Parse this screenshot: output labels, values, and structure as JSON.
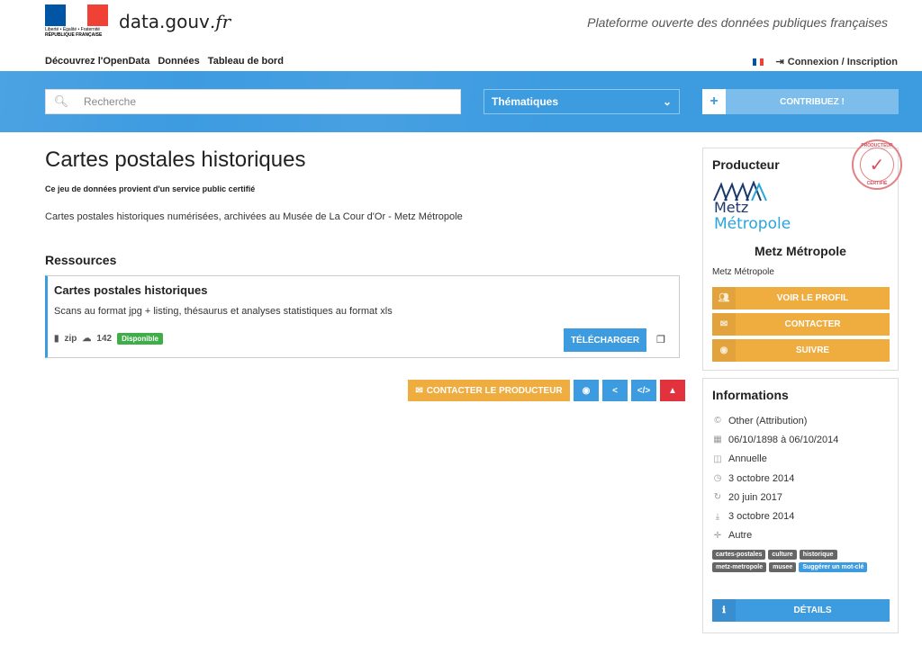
{
  "header": {
    "logo_lines": [
      "Liberté • Égalité • Fraternité",
      "RÉPUBLIQUE FRANÇAISE"
    ],
    "brand_main": "data.gouv",
    "brand_tld": ".fr",
    "tagline": "Plateforme ouverte des données publiques françaises",
    "nav": [
      "Découvrez l'OpenData",
      "Données",
      "Tableau de bord"
    ],
    "login": "Connexion / Inscription",
    "colors": {
      "blue": "#0055a4",
      "white": "#ffffff",
      "red": "#ef4135"
    }
  },
  "search": {
    "placeholder": "Recherche",
    "themes_label": "Thématiques",
    "contribute_label": "CONTRIBUEZ !"
  },
  "dataset": {
    "title": "Cartes postales historiques",
    "certified_note": "Ce jeu de données provient d'un service public certifié",
    "description": "Cartes postales historiques numérisées, archivées au Musée de La Cour d'Or - Metz Métropole"
  },
  "resources": {
    "heading": "Ressources",
    "items": [
      {
        "title": "Cartes postales historiques",
        "description": "Scans au format jpg + listing, thésaurus et analyses statistiques au format xls",
        "format": "zip",
        "downloads": "142",
        "status": "Disponible",
        "download_label": "TÉLÉCHARGER"
      }
    ]
  },
  "actions": {
    "contact_producer": "CONTACTER LE PRODUCTEUR"
  },
  "producer": {
    "heading": "Producteur",
    "stamp_top": "PRODUCTEUR",
    "stamp_bottom": "CERTIFIÉ",
    "logo_line1": "Metz",
    "logo_line2": "Métropole",
    "name": "Metz Métropole",
    "subtitle": "Metz Métropole",
    "buttons": [
      "VOIR LE PROFIL",
      "CONTACTER",
      "SUIVRE"
    ]
  },
  "info": {
    "heading": "Informations",
    "rows": [
      {
        "icon": "copyright-icon",
        "text": "Other (Attribution)"
      },
      {
        "icon": "calendar-icon",
        "text": "06/10/1898 à 06/10/2014"
      },
      {
        "icon": "frequency-icon",
        "text": "Annuelle"
      },
      {
        "icon": "clock-icon",
        "text": "3 octobre 2014"
      },
      {
        "icon": "refresh-icon",
        "text": "20 juin 2017"
      },
      {
        "icon": "download-icon",
        "text": "3 octobre 2014"
      },
      {
        "icon": "crosshair-icon",
        "text": "Autre"
      }
    ],
    "tags": [
      "cartes-postales",
      "culture",
      "historique",
      "metz-metropole",
      "musee"
    ],
    "suggest_label": "Suggérer un mot-clé",
    "details_label": "DÉTAILS"
  },
  "accent_colors": {
    "blue": "#3d9be0",
    "orange": "#efac3f",
    "red": "#e2323d",
    "green": "#3fae49"
  }
}
